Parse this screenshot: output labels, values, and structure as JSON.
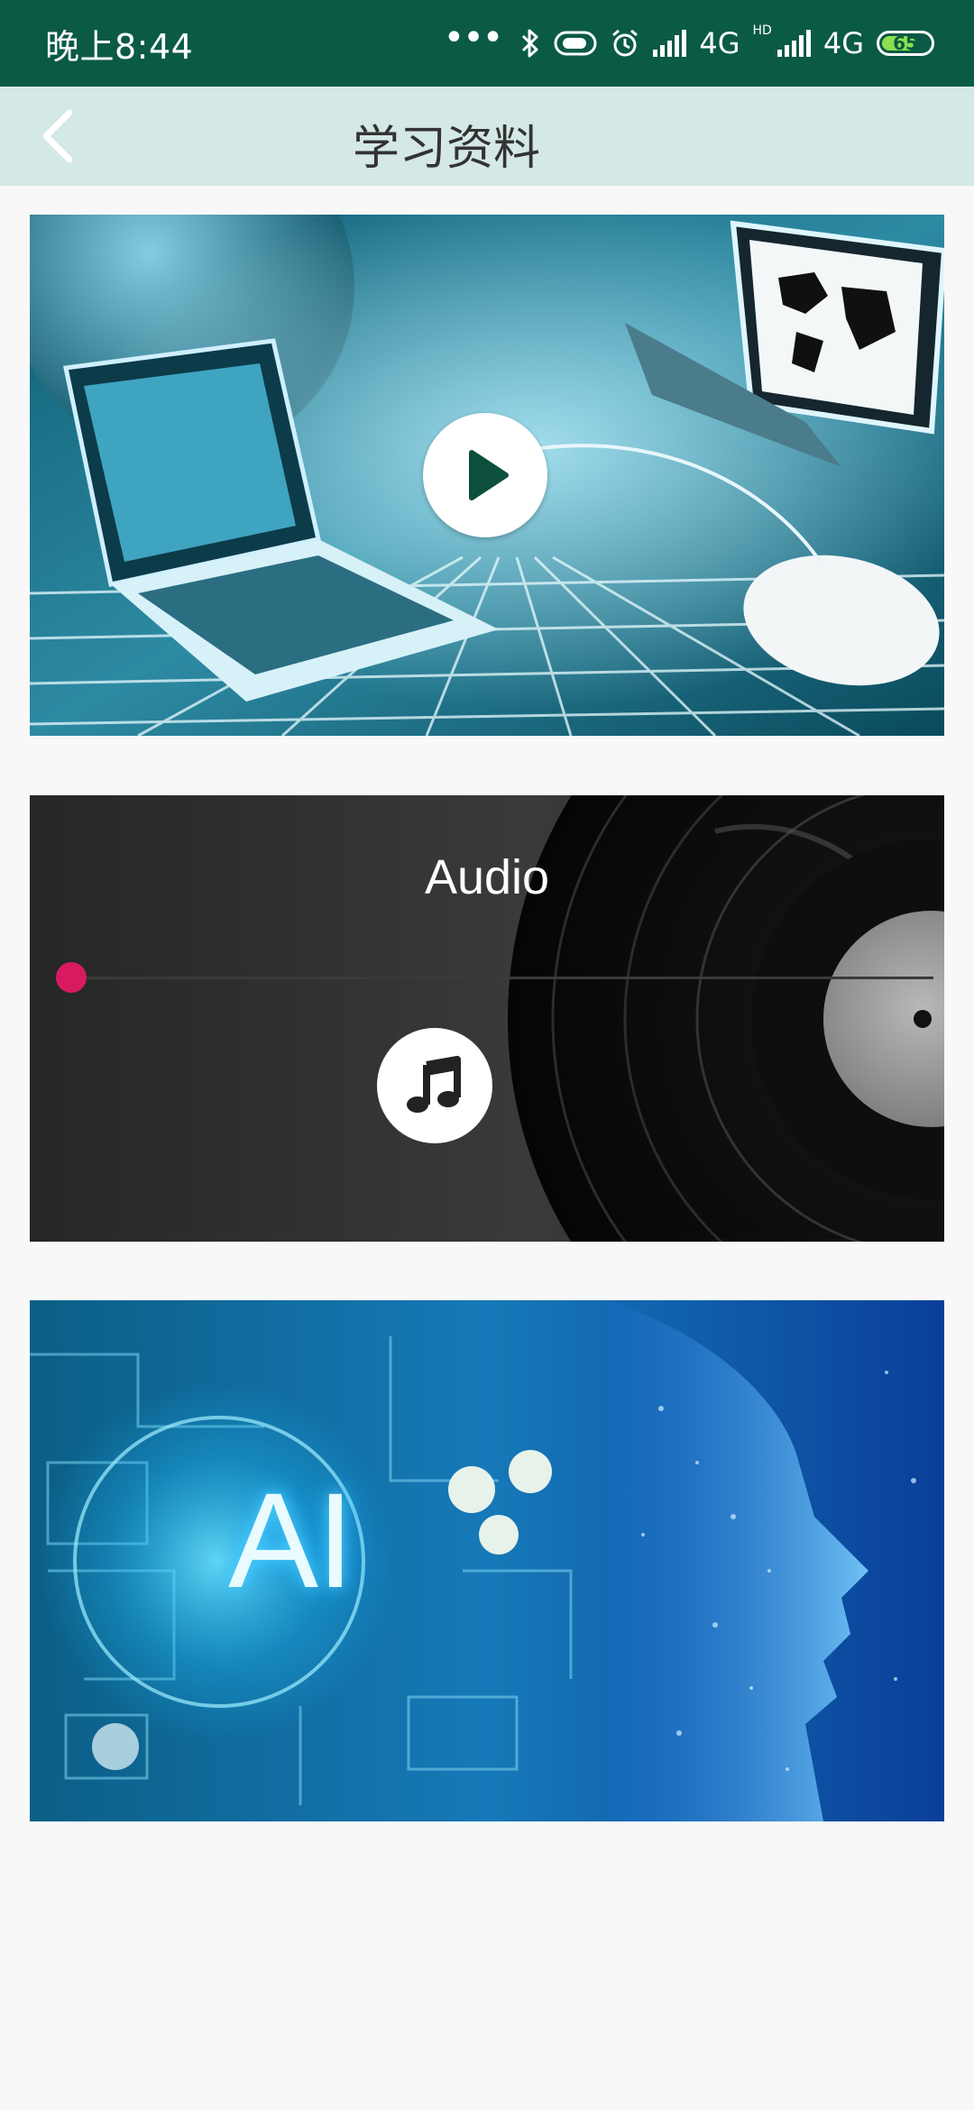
{
  "status_bar": {
    "time": "晚上8:44",
    "dots": "•••",
    "network_1": "4G",
    "hd": "HD",
    "network_2": "4G",
    "battery_level": "65",
    "icons": [
      "bluetooth-icon",
      "toggle-icon",
      "alarm-icon",
      "signal-icon",
      "signal-icon",
      "battery-icon"
    ]
  },
  "app_bar": {
    "title": "学习资料",
    "back_icon": "chevron-left-icon"
  },
  "cards": {
    "video": {
      "icon": "play-icon"
    },
    "audio": {
      "title": "Audio",
      "icon": "music-note-icon",
      "progress": 0
    },
    "ai": {
      "image_text": "AI"
    }
  },
  "colors": {
    "status_bar_bg": "#0b5a45",
    "app_bar_bg": "#d4e8e6",
    "page_bg": "#f8f8f8",
    "audio_accent": "#d81b60",
    "battery_fill": "#8be04e"
  }
}
